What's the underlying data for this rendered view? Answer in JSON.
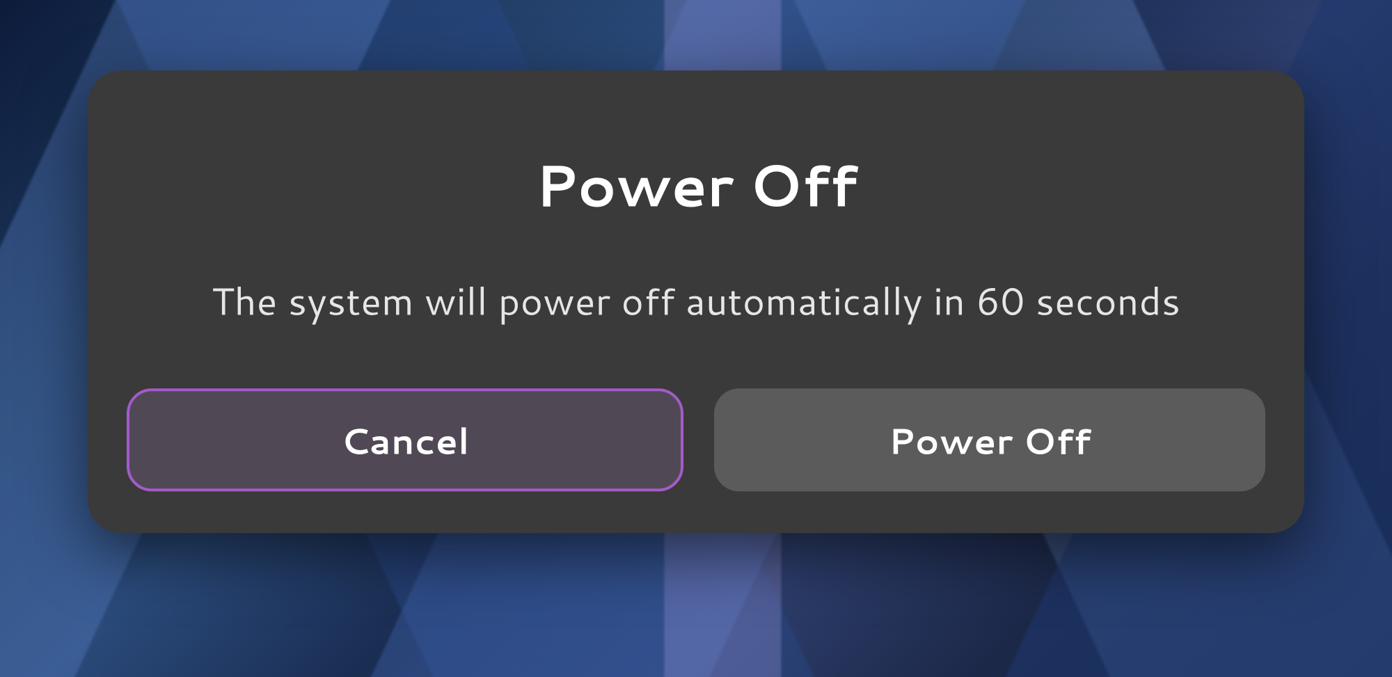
{
  "dialog": {
    "title": "Power Off",
    "message": "The system will power off automatically in 60 seconds",
    "buttons": {
      "cancel_label": "Cancel",
      "poweroff_label": "Power Off"
    }
  },
  "colors": {
    "dialog_bg": "#3a3a3a",
    "focus_border": "#a45bc8",
    "button_default_bg": "#5b5b5b",
    "button_focused_bg": "#504955",
    "text_primary": "#ffffff",
    "text_secondary": "#e6e6e6"
  }
}
